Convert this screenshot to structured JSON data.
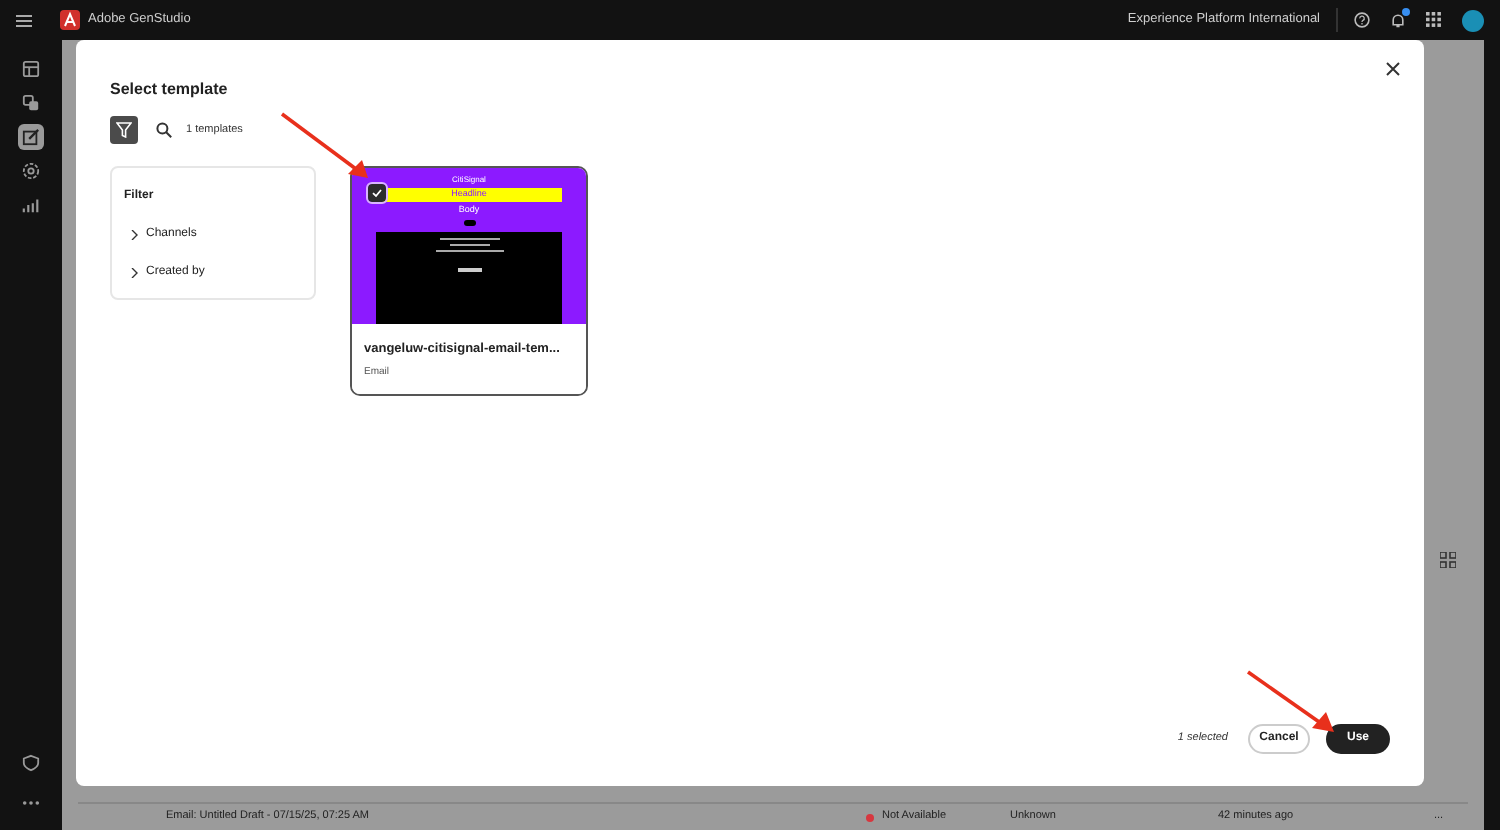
{
  "top_bar": {
    "app_name": "Adobe GenStudio",
    "org": "Experience Platform International",
    "notification_badge": true
  },
  "sidebar": {
    "items": [
      {
        "kind": "calendar",
        "selected": false
      },
      {
        "kind": "assets",
        "selected": false
      },
      {
        "kind": "create",
        "selected": true
      },
      {
        "kind": "settings",
        "selected": false
      },
      {
        "kind": "insights",
        "selected": false
      }
    ],
    "bottom": [
      {
        "kind": "shield"
      },
      {
        "kind": "more"
      }
    ]
  },
  "background": {
    "rows": [
      {
        "name": "Email: Untitled Draft - 07/15/25, 07:25 AM",
        "status": "Not Available",
        "color": "#d7373f",
        "owner": "Unknown",
        "modified": "42 minutes ago",
        "menu": "..."
      }
    ]
  },
  "dialog": {
    "title": "Select template",
    "filter_selected": true,
    "count": "1 templates",
    "filter_panel": {
      "title": "Filter",
      "groups": [
        {
          "label": "Channels",
          "expanded": false
        },
        {
          "label": "Created by",
          "expanded": false
        }
      ]
    },
    "templates": [
      {
        "name": "vangeluw-citisignal-email-tem...",
        "type": "Email",
        "selected": true,
        "preview": {
          "brand": "CitiSignal",
          "headline": "Headline",
          "body": "Body"
        }
      }
    ],
    "selection_text": "1 selected",
    "buttons": [
      {
        "label": "Cancel",
        "kind": "secondary"
      },
      {
        "label": "Use",
        "kind": "primary"
      }
    ]
  }
}
